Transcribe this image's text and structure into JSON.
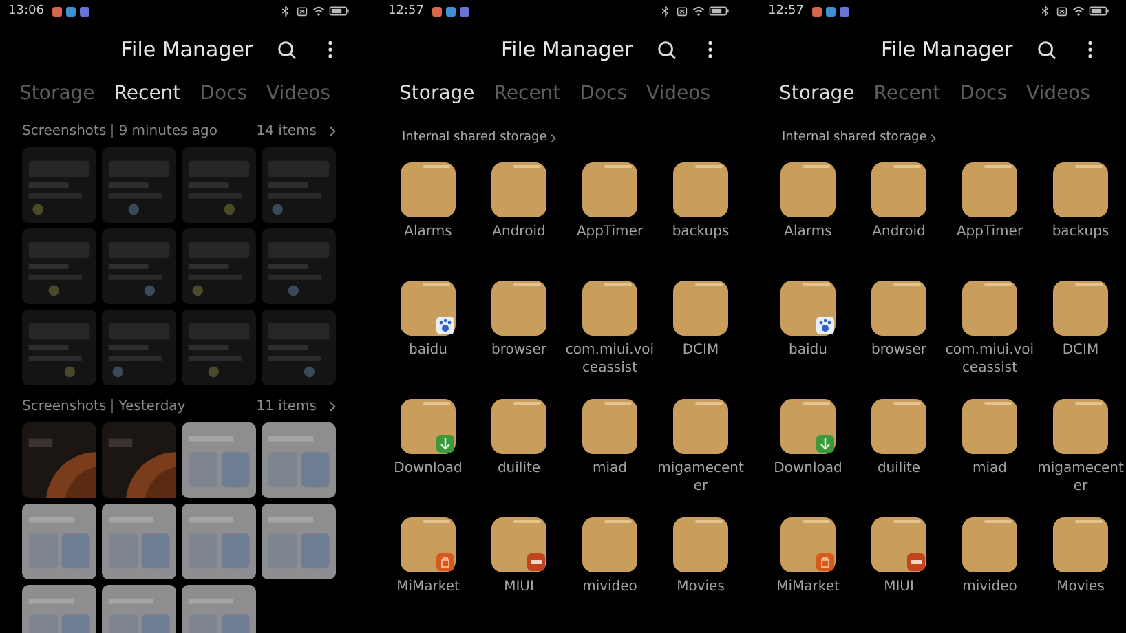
{
  "panels": [
    {
      "kind": "recent",
      "status_bar": {
        "time": "13:06"
      },
      "title": "File Manager",
      "tabs": [
        {
          "label": "Storage",
          "selected": false
        },
        {
          "label": "Recent",
          "selected": true
        },
        {
          "label": "Docs",
          "selected": false
        },
        {
          "label": "Videos",
          "selected": false
        }
      ],
      "sections": [
        {
          "source": "Screenshots",
          "when": "9 minutes ago",
          "count": "14 items"
        },
        {
          "source": "Screenshots",
          "when": "Yesterday",
          "count": "11 items"
        }
      ]
    },
    {
      "kind": "storage",
      "status_bar": {
        "time": "12:57"
      },
      "title": "File Manager",
      "tabs": [
        {
          "label": "Storage",
          "selected": true
        },
        {
          "label": "Recent",
          "selected": false
        },
        {
          "label": "Docs",
          "selected": false
        },
        {
          "label": "Videos",
          "selected": false
        }
      ],
      "breadcrumb": "Internal shared storage",
      "folders": [
        {
          "name": "Alarms"
        },
        {
          "name": "Android"
        },
        {
          "name": "AppTimer"
        },
        {
          "name": "backups"
        },
        {
          "name": "baidu",
          "badge": {
            "kind": "paw"
          }
        },
        {
          "name": "browser"
        },
        {
          "name": "com.miui.voiceassist"
        },
        {
          "name": "DCIM"
        },
        {
          "name": "Download",
          "badge": {
            "kind": "download"
          }
        },
        {
          "name": "duilite"
        },
        {
          "name": "miad"
        },
        {
          "name": "migamecenter"
        },
        {
          "name": "MiMarket",
          "badge": {
            "kind": "bag"
          }
        },
        {
          "name": "MIUI",
          "badge": {
            "kind": "miui"
          }
        },
        {
          "name": "mivideo"
        },
        {
          "name": "Movies"
        }
      ]
    },
    {
      "kind": "storage",
      "status_bar": {
        "time": "12:57"
      },
      "title": "File Manager",
      "tabs": [
        {
          "label": "Storage",
          "selected": true
        },
        {
          "label": "Recent",
          "selected": false
        },
        {
          "label": "Docs",
          "selected": false
        },
        {
          "label": "Videos",
          "selected": false
        }
      ],
      "breadcrumb": "Internal shared storage",
      "folders": [
        {
          "name": "Alarms"
        },
        {
          "name": "Android"
        },
        {
          "name": "AppTimer"
        },
        {
          "name": "backups"
        },
        {
          "name": "baidu",
          "badge": {
            "kind": "paw"
          }
        },
        {
          "name": "browser"
        },
        {
          "name": "com.miui.voiceassist"
        },
        {
          "name": "DCIM"
        },
        {
          "name": "Download",
          "badge": {
            "kind": "download"
          }
        },
        {
          "name": "duilite"
        },
        {
          "name": "miad"
        },
        {
          "name": "migamecenter"
        },
        {
          "name": "MiMarket",
          "badge": {
            "kind": "bag"
          }
        },
        {
          "name": "MIUI",
          "badge": {
            "kind": "miui"
          }
        },
        {
          "name": "mivideo"
        },
        {
          "name": "Movies"
        }
      ]
    }
  ]
}
